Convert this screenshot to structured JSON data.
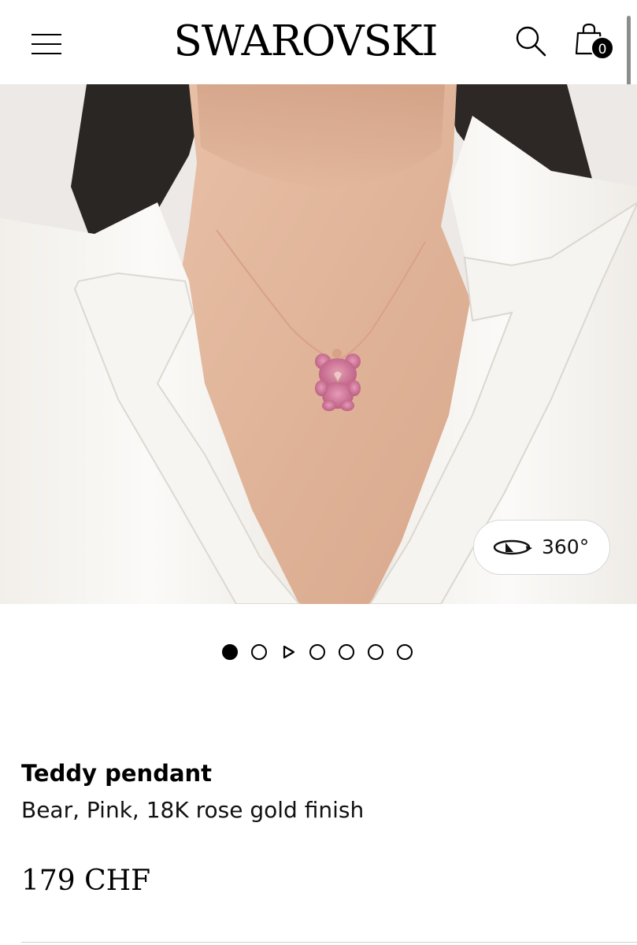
{
  "header": {
    "brand": "SWAROVSKI",
    "menu_icon": "hamburger-menu-icon",
    "search_icon": "search-icon",
    "bag_icon": "shopping-bag-icon",
    "bag_count": "0"
  },
  "gallery": {
    "image_alt": "Model wearing pink teddy bear pendant necklace with white blazer",
    "view_360_icon": "rotate-360-icon",
    "view_360_label": "360°",
    "slides": [
      "image",
      "image",
      "video",
      "image",
      "image",
      "image",
      "image"
    ],
    "active_slide": 0
  },
  "product": {
    "name": "Teddy pendant",
    "description": "Bear, Pink, 18K rose gold finish",
    "price": "179 CHF"
  },
  "colors": {
    "text": "#000000",
    "background": "#ffffff",
    "pendant_pink": "#c96a8e",
    "chain_rose_gold": "#d9a08a"
  }
}
